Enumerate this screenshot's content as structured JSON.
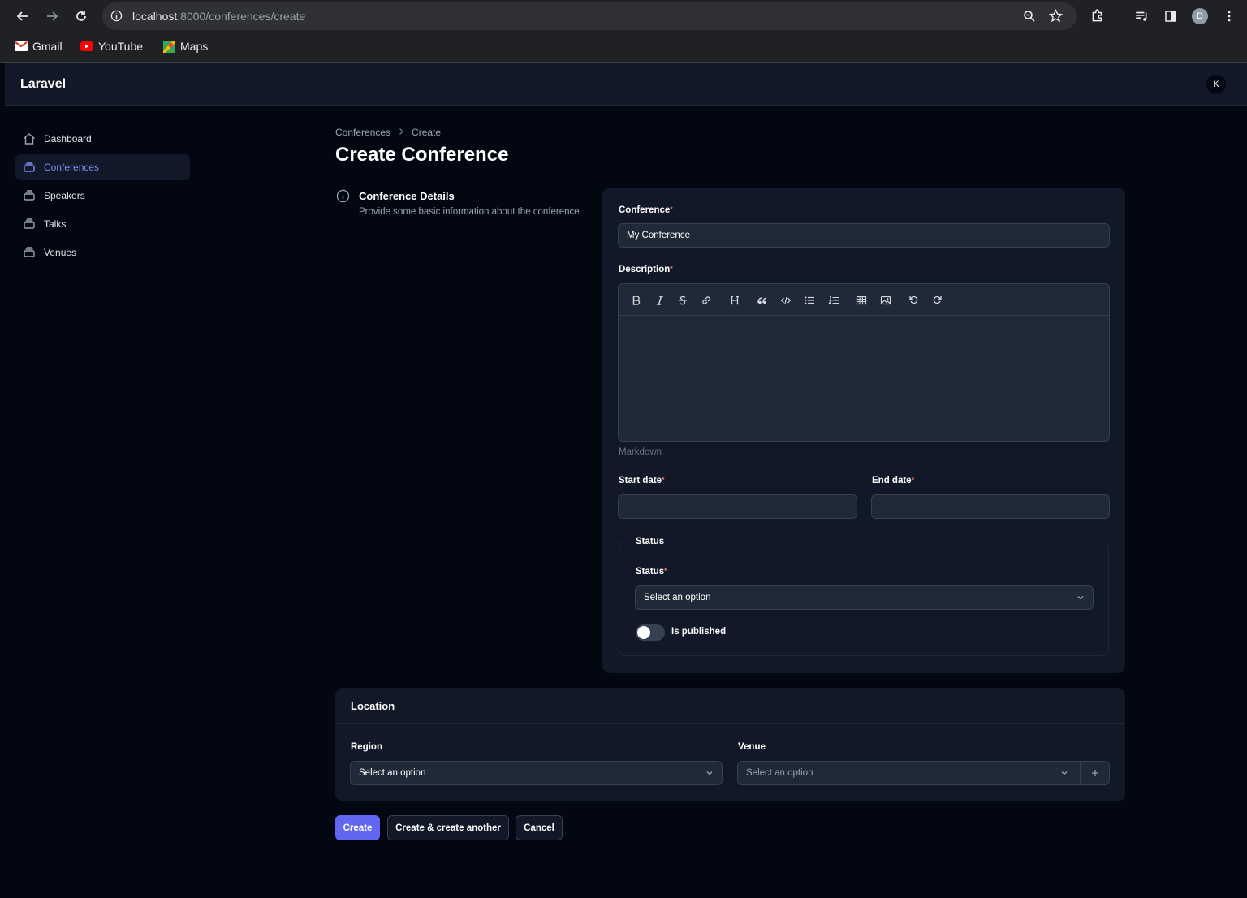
{
  "browser": {
    "url_host": "localhost",
    "url_rest": ":8000/conferences/create",
    "profile_initial": "D",
    "bookmarks": [
      {
        "label": "Gmail",
        "icon": "gmail-icon"
      },
      {
        "label": "YouTube",
        "icon": "youtube-icon"
      },
      {
        "label": "Maps",
        "icon": "maps-icon"
      }
    ]
  },
  "app": {
    "brand": "Laravel",
    "user_initial": "K"
  },
  "sidebar": {
    "items": [
      {
        "label": "Dashboard",
        "icon": "home-icon",
        "active": false
      },
      {
        "label": "Conferences",
        "icon": "stack-icon",
        "active": true
      },
      {
        "label": "Speakers",
        "icon": "stack-icon",
        "active": false
      },
      {
        "label": "Talks",
        "icon": "stack-icon",
        "active": false
      },
      {
        "label": "Venues",
        "icon": "stack-icon",
        "active": false
      }
    ]
  },
  "breadcrumb": [
    "Conferences",
    "Create"
  ],
  "page_title": "Create Conference",
  "details_section": {
    "title": "Conference Details",
    "description": "Provide some basic information about the conference"
  },
  "form": {
    "conference_label": "Conference",
    "conference_value": "My Conference",
    "description_label": "Description",
    "description_hint": "Markdown",
    "start_date_label": "Start date",
    "end_date_label": "End date",
    "status_fieldset": "Status",
    "status_label": "Status",
    "status_placeholder": "Select an option",
    "is_published_label": "Is published",
    "is_published": false
  },
  "location": {
    "title": "Location",
    "region_label": "Region",
    "region_placeholder": "Select an option",
    "venue_label": "Venue",
    "venue_placeholder": "Select an option"
  },
  "actions": {
    "create": "Create",
    "create_another": "Create & create another",
    "cancel": "Cancel"
  },
  "colors": {
    "accent": "#6366f1",
    "active_nav": "#818cf8",
    "required": "#f87171"
  }
}
